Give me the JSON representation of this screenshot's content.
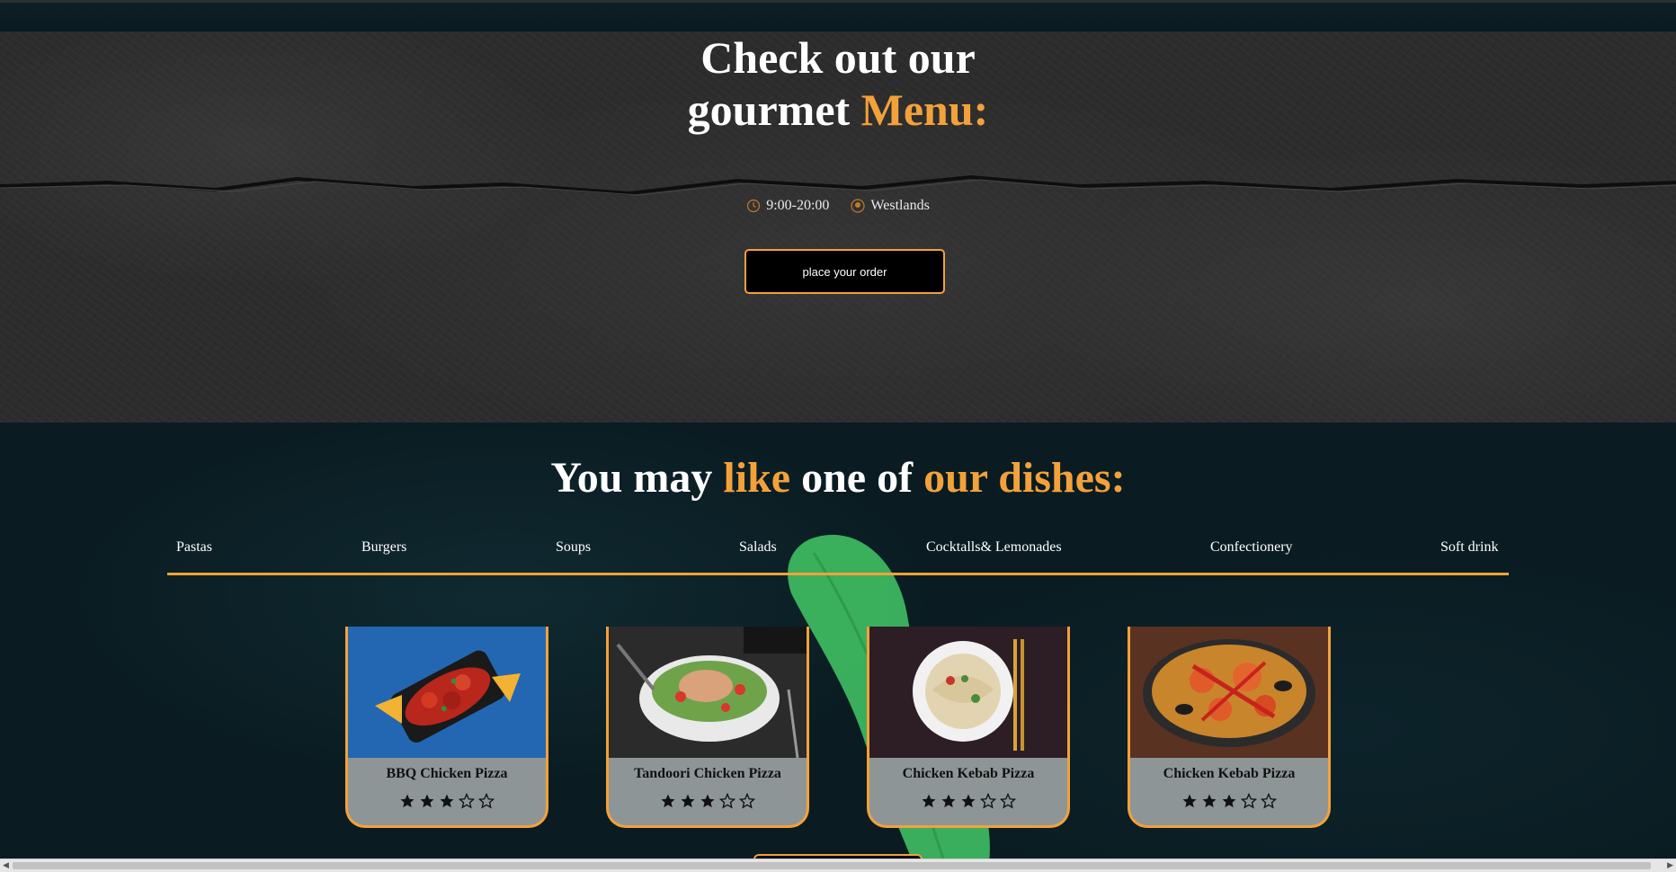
{
  "hero": {
    "title_line1": "Check out our",
    "title_line2_plain": "gourmet ",
    "title_line2_accent": "Menu:",
    "hours": "9:00-20:00",
    "location": "Westlands",
    "order_button": "place your order",
    "clock_icon": "clock-icon",
    "location_icon": "location-pin-icon"
  },
  "dishes": {
    "title_part1": "You may ",
    "title_part2": "like",
    "title_part3": " one of ",
    "title_part4": "our dishes:",
    "tabs": [
      "Pastas",
      "Burgers",
      "Soups",
      "Salads",
      "Cocktalls& Lemonades",
      "Confectionery",
      "Soft drink"
    ],
    "cards": [
      {
        "name": "BBQ Chicken Pizza",
        "rating": 3,
        "max_rating": 5
      },
      {
        "name": "Tandoori Chicken Pizza",
        "rating": 3,
        "max_rating": 5
      },
      {
        "name": "Chicken Kebab Pizza",
        "rating": 3,
        "max_rating": 5
      },
      {
        "name": "Chicken Kebab Pizza",
        "rating": 3,
        "max_rating": 5
      }
    ]
  },
  "colors": {
    "accent": "#f3a13a",
    "card_bg": "#8e9597",
    "section_bg": "#0a1c22"
  }
}
